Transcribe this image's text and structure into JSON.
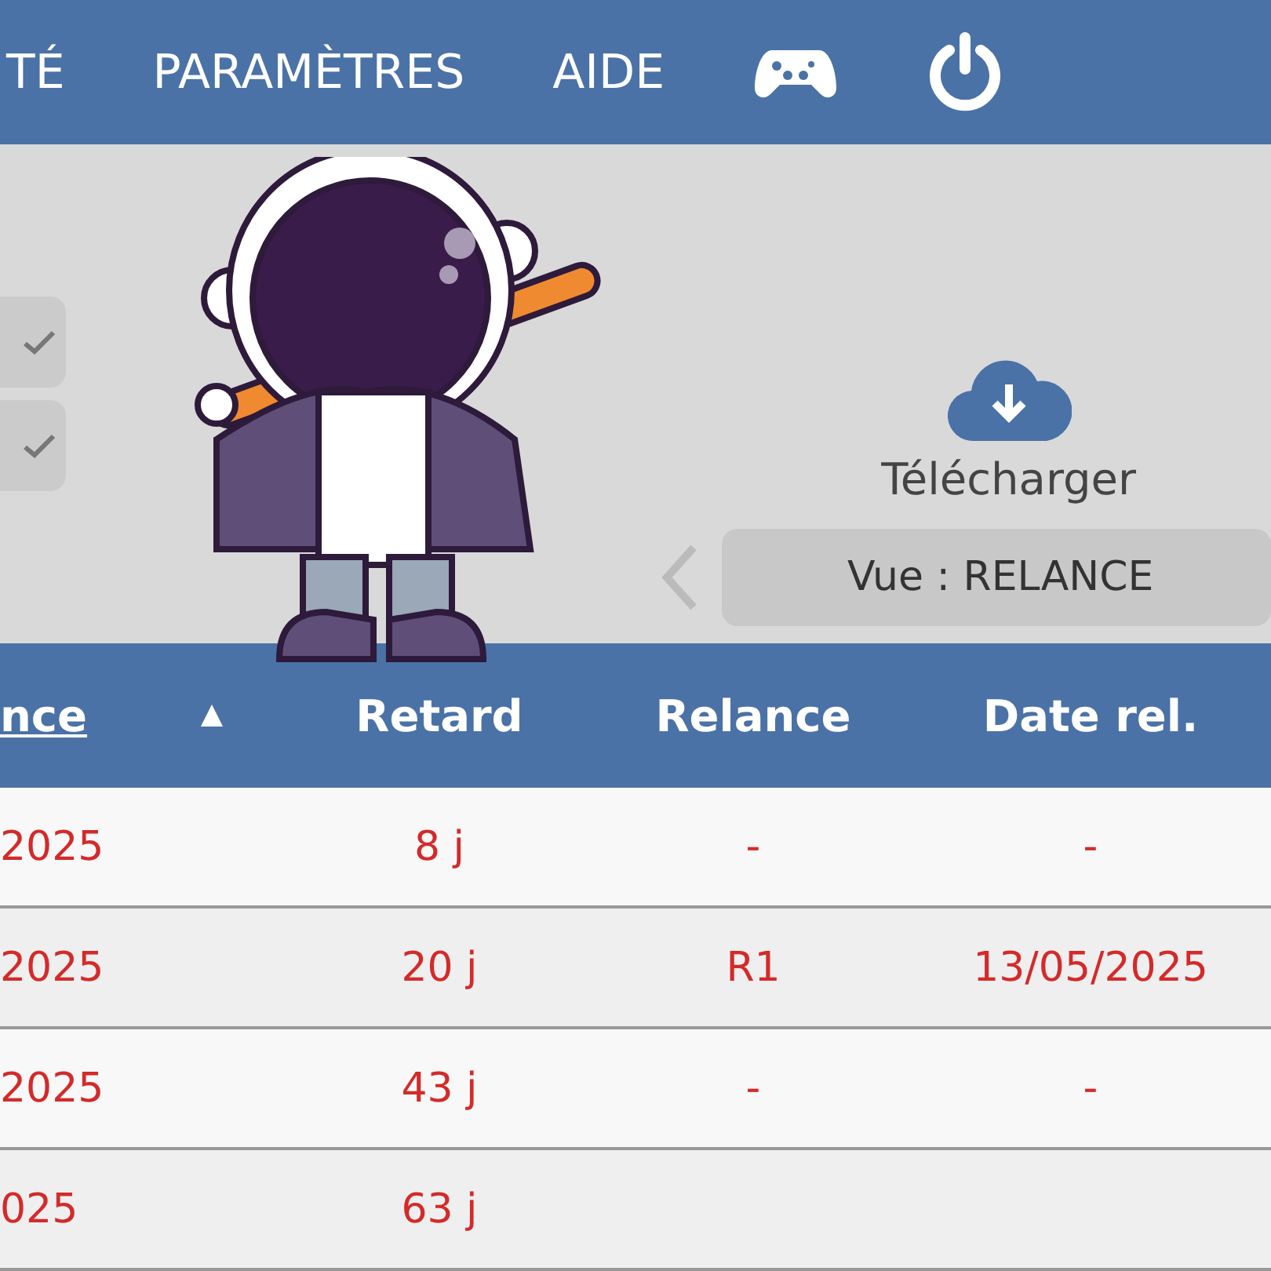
{
  "nav": {
    "items": [
      "TÉ",
      "PARAMÈTRES",
      "AIDE"
    ]
  },
  "toolbar": {
    "toggles": [
      {
        "checked": true
      },
      {
        "checked": true
      }
    ],
    "download_label": "Télécharger",
    "view_label": "Vue : RELANCE"
  },
  "table": {
    "columns": [
      {
        "label": "nce",
        "sortable": true
      },
      {
        "label": "▲",
        "kind": "sort"
      },
      {
        "label": "Retard"
      },
      {
        "label": "Relance"
      },
      {
        "label": "Date rel."
      }
    ],
    "rows": [
      [
        "2025",
        "",
        "8 j",
        "-",
        "-"
      ],
      [
        "2025",
        "",
        "20 j",
        "R1",
        "13/05/2025"
      ],
      [
        "2025",
        "",
        "43 j",
        "-",
        "-"
      ],
      [
        "025",
        "",
        "63 j",
        "",
        ""
      ]
    ]
  }
}
